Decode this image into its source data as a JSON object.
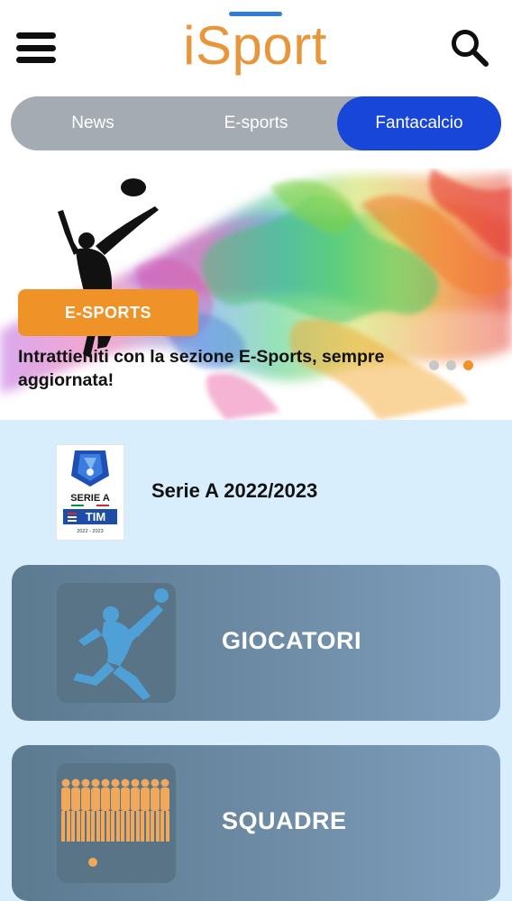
{
  "header": {
    "logo_text": "iSport",
    "menu_icon": "hamburger-menu-icon",
    "search_icon": "search-icon",
    "accent_color": "#2f7dd6",
    "logo_color": "#e9953a"
  },
  "tabs": {
    "items": [
      {
        "label": "News",
        "active": false
      },
      {
        "label": "E-sports",
        "active": false
      },
      {
        "label": "Fantacalcio",
        "active": true
      }
    ],
    "active_color": "#1746d9"
  },
  "hero": {
    "badge": "E-SPORTS",
    "caption": "Intrattieniti con la sezione E-Sports, sempre aggiornata!",
    "slides_count": 3,
    "active_slide": 3,
    "badge_color": "#ef9228"
  },
  "league": {
    "logo": {
      "line1": "SERIE A",
      "line2": "TIM",
      "season_small": "2022 - 2023"
    },
    "title": "Serie A 2022/2023"
  },
  "cards": [
    {
      "label": "GIOCATORI",
      "icon": "soccer-player-kick-icon"
    },
    {
      "label": "SQUADRE",
      "icon": "team-lineup-icon"
    }
  ]
}
